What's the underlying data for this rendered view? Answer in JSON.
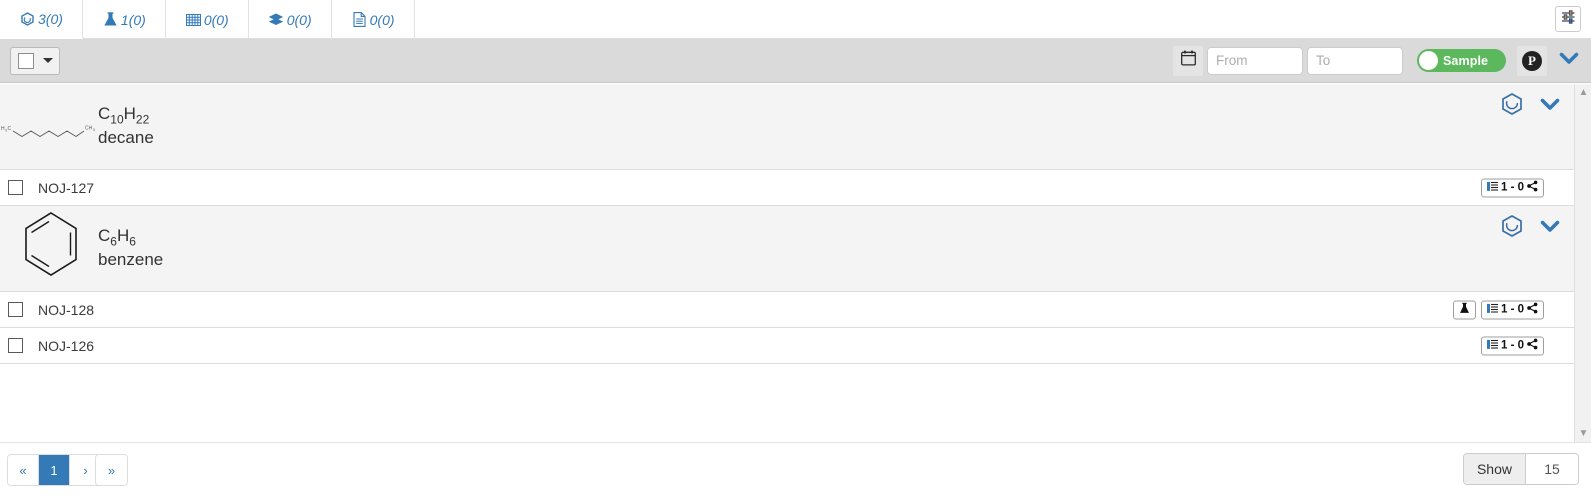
{
  "tabs": [
    {
      "icon": "molecule-icon",
      "label": "3(0)",
      "active": true
    },
    {
      "icon": "flask-icon",
      "label": "1(0)",
      "active": false
    },
    {
      "icon": "grid-icon",
      "label": "0(0)",
      "active": false
    },
    {
      "icon": "layers-icon",
      "label": "0(0)",
      "active": false
    },
    {
      "icon": "document-icon",
      "label": "0(0)",
      "active": false
    }
  ],
  "header": {
    "settings_icon": "sliders-icon"
  },
  "toolbar": {
    "select_all_icon": "checkbox-dropdown",
    "calendar_icon": "calendar-icon",
    "from_placeholder": "From",
    "from_value": "",
    "to_placeholder": "To",
    "to_value": "",
    "toggle_label": "Sample",
    "toggle_on": true,
    "toggle_color": "#5cb85c",
    "p_button_label": "P",
    "chevron_icon": "chevron-down-icon",
    "accent_color": "#337ab7"
  },
  "list": {
    "groups": [
      {
        "molecule": {
          "structure": "decane-chain",
          "left_label": "H3C",
          "right_label": "CH3",
          "formula_main": "C",
          "formula_parts": [
            {
              "text": "C",
              "sub": "10"
            },
            {
              "text": "H",
              "sub": "22"
            }
          ],
          "formula_plain": "C10H22",
          "name": "decane",
          "hex_icon": "benzene-ring-icon",
          "chevron_icon": "chevron-down-icon"
        },
        "samples": [
          {
            "name": "NOJ-127",
            "checked": false,
            "badges": [
              {
                "type": "analysis",
                "list_icon": "list-icon",
                "text": "1 - 0",
                "share_icon": "share-icon"
              }
            ]
          }
        ]
      },
      {
        "molecule": {
          "structure": "benzene-ring",
          "formula_parts": [
            {
              "text": "C",
              "sub": "6"
            },
            {
              "text": "H",
              "sub": "6"
            }
          ],
          "formula_plain": "C6H6",
          "name": "benzene",
          "hex_icon": "benzene-ring-icon",
          "chevron_icon": "chevron-down-icon"
        },
        "samples": [
          {
            "name": "NOJ-128",
            "checked": false,
            "badges": [
              {
                "type": "reaction",
                "icon": "flask-icon"
              },
              {
                "type": "analysis",
                "list_icon": "list-icon",
                "text": "1 - 0",
                "share_icon": "share-icon"
              }
            ]
          },
          {
            "name": "NOJ-126",
            "checked": false,
            "badges": [
              {
                "type": "analysis",
                "list_icon": "list-icon",
                "text": "1 - 0",
                "share_icon": "share-icon"
              }
            ]
          }
        ]
      }
    ]
  },
  "footer": {
    "pagination": {
      "first": "«",
      "pages": [
        {
          "label": "1",
          "active": true
        }
      ],
      "next": "›",
      "last": "»"
    },
    "show_label": "Show",
    "show_value": "15"
  }
}
